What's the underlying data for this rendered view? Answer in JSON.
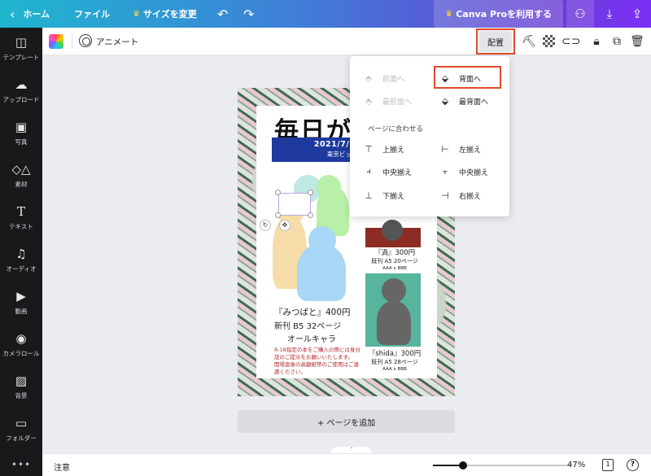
{
  "topbar": {
    "home": "ホーム",
    "file": "ファイル",
    "resize": "サイズを変更",
    "undo_icon": "undo-icon",
    "redo_icon": "redo-icon",
    "pro_button": "Canva Proを利用する",
    "share_icon": "users-icon",
    "download_icon": "download-icon",
    "upload_icon": "share-upload-icon"
  },
  "rail": {
    "items": [
      {
        "label": "テンプレート",
        "icon": "template-icon"
      },
      {
        "label": "アップロード",
        "icon": "upload-icon"
      },
      {
        "label": "写真",
        "icon": "photo-icon"
      },
      {
        "label": "素材",
        "icon": "elements-icon"
      },
      {
        "label": "テキスト",
        "icon": "text-icon"
      },
      {
        "label": "オーディオ",
        "icon": "audio-icon"
      },
      {
        "label": "動画",
        "icon": "video-icon"
      },
      {
        "label": "カメラロール",
        "icon": "camera-icon"
      },
      {
        "label": "背景",
        "icon": "background-icon"
      },
      {
        "label": "フォルダー",
        "icon": "folder-icon"
      }
    ],
    "more": "•••"
  },
  "toolbar": {
    "animate": "アニメート",
    "arrange": "配置"
  },
  "arrange_menu": {
    "forward": "前面へ",
    "backward": "背面へ",
    "to_front": "最前面へ",
    "to_back": "最背面へ",
    "align_section": "ページに合わせる",
    "top": "上揃え",
    "left": "左揃え",
    "middle": "中央揃え",
    "center": "中央揃え",
    "bottom": "下揃え",
    "right": "右揃え"
  },
  "poster": {
    "title": "毎日が",
    "band_line1": "2021/7/18 SUPER",
    "band_line2": "東京ビッグサイト西",
    "book1_title": "『みつばと』400円",
    "book1_info": "新刊 B5 32ページ",
    "book1_sub": "オールキャラ",
    "notes": [
      "R-18指定の本をご購入の際には身分証のご提示をお願いいたします。",
      "開場直後の高額紙幣のご使用はご遠慮ください。"
    ],
    "book2_title": "『渦』300円",
    "book2_info": "既刊 A5 20ページ",
    "book2_sub": "AAA x BBB",
    "book3_title": "『shida』300円",
    "book3_info": "既刊 A5 28ページ",
    "book3_sub": "AAA x BBB"
  },
  "add_page": "+ ページを追加",
  "bottombar": {
    "notes": "注意",
    "zoom": "47%",
    "zoom_fraction": 0.47,
    "page_count": "1",
    "help": "?"
  },
  "colors": {
    "highlight": "#e34a2c",
    "band": "#1e3a9e",
    "rail_bg": "#18191b"
  }
}
